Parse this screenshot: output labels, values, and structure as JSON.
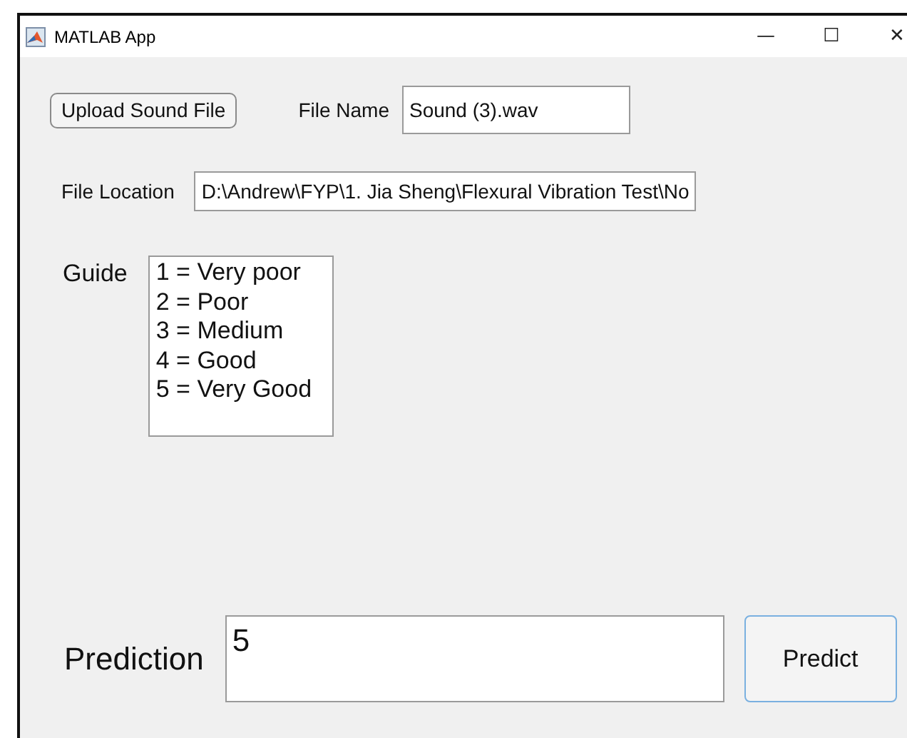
{
  "window": {
    "title": "MATLAB App",
    "controls": [
      "—",
      "☐",
      "✕"
    ]
  },
  "upload_button": {
    "label": "Upload Sound File"
  },
  "file_name": {
    "label": "File Name",
    "value": "Sound (3).wav"
  },
  "file_location": {
    "label": "File Location",
    "value": "D:\\Andrew\\FYP\\1. Jia Sheng\\Flexural Vibration Test\\No"
  },
  "guide": {
    "label": "Guide",
    "items": [
      "1 = Very poor",
      "2 = Poor",
      "3 = Medium",
      "4 = Good",
      "5 = Very Good"
    ]
  },
  "prediction": {
    "label": "Prediction",
    "value": "5"
  },
  "predict_button": {
    "label": "Predict"
  }
}
